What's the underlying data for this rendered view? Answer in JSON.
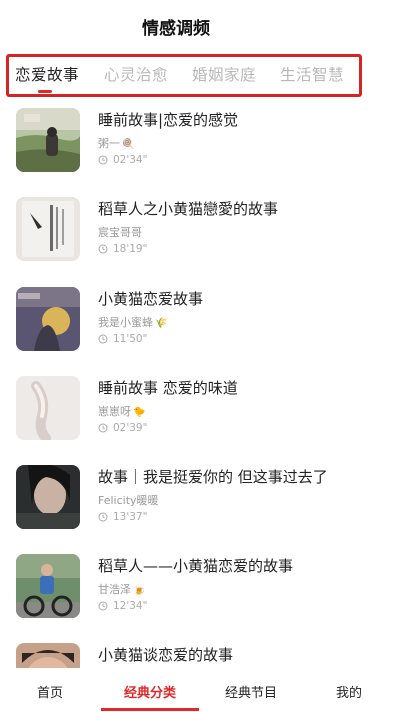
{
  "header": {
    "title": "情感调频"
  },
  "tabs": [
    {
      "label": "恋爱故事",
      "active": true
    },
    {
      "label": "心灵治愈",
      "active": false
    },
    {
      "label": "婚姻家庭",
      "active": false
    },
    {
      "label": "生活智慧",
      "active": false
    }
  ],
  "items": [
    {
      "title": "睡前故事|恋爱的感觉",
      "author": "粥一",
      "author_emoji": "🍭",
      "duration": "02'34\""
    },
    {
      "title": "稻草人之小黄猫戀愛的故事",
      "author": "宸宝哥哥",
      "author_emoji": "",
      "duration": "18'19\""
    },
    {
      "title": "小黄猫恋爱故事",
      "author": "我是小蜜蜂",
      "author_emoji": "🌾",
      "duration": "11'50\""
    },
    {
      "title": "睡前故事 恋爱的味道",
      "author": "崽崽呀",
      "author_emoji": "🐤",
      "duration": "02'39\""
    },
    {
      "title": "故事｜我是挺爱你的 但这事过去了",
      "author": "Felicity暖暖",
      "author_emoji": "",
      "duration": "13'37\""
    },
    {
      "title": "稻草人——小黄猫恋爱的故事",
      "author": "甘浩泽",
      "author_emoji": "🍺",
      "duration": "12'34\""
    },
    {
      "title": "小黄猫谈恋爱的故事",
      "author": "",
      "author_emoji": "",
      "duration": ""
    }
  ],
  "bottom_nav": [
    {
      "label": "首页",
      "active": false
    },
    {
      "label": "经典分类",
      "active": true
    },
    {
      "label": "经典节目",
      "active": false
    },
    {
      "label": "我的",
      "active": false
    }
  ],
  "colors": {
    "accent": "#e02a2a",
    "highlight_box": "#d42424"
  }
}
